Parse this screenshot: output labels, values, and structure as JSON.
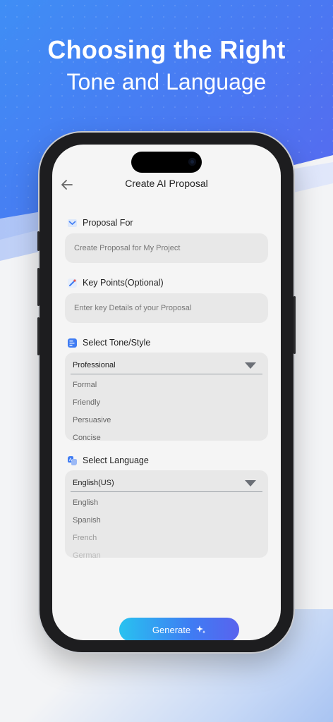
{
  "headline": {
    "line1": "Choosing the Right",
    "line2": "Tone and Language"
  },
  "screen": {
    "title": "Create AI Proposal",
    "proposal_for": {
      "label": "Proposal For",
      "placeholder": "Create Proposal for My Project"
    },
    "key_points": {
      "label": "Key Points(Optional)",
      "placeholder": "Enter key Details of your Proposal"
    },
    "tone": {
      "label": "Select Tone/Style",
      "selected": "Professional",
      "options": [
        "Formal",
        "Friendly",
        "Persuasive",
        "Concise"
      ]
    },
    "language": {
      "label": "Select Language",
      "selected": "English(US)",
      "options": [
        "English",
        "Spanish",
        "French",
        "German"
      ]
    },
    "generate_label": "Generate"
  },
  "colors": {
    "accent_start": "#28c2f0",
    "accent_end": "#5963ee",
    "hero_blue": "#4a78f2"
  },
  "icons": {
    "back": "arrow-left-icon",
    "proposal": "proposal-icon",
    "key_points": "pen-icon",
    "tone": "tone-icon",
    "language": "translate-icon",
    "generate": "sparkle-icon"
  }
}
